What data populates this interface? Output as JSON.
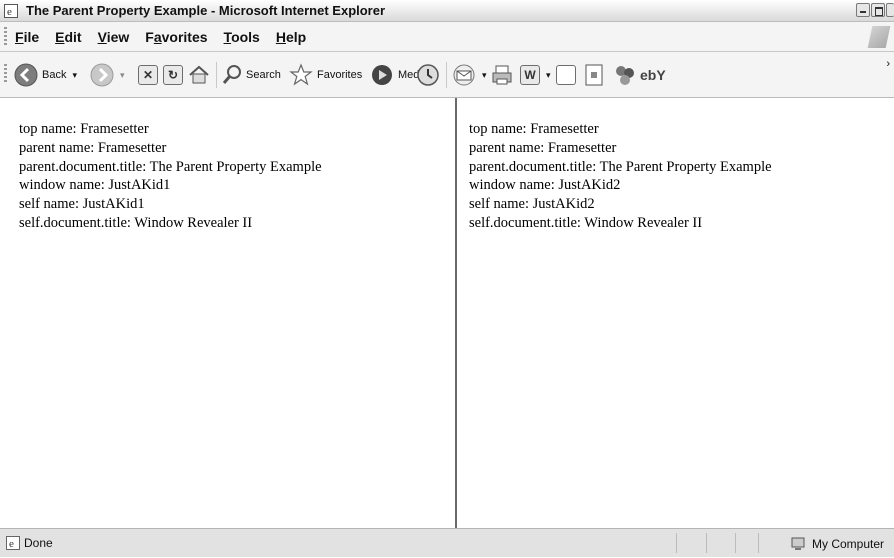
{
  "window": {
    "title": "The Parent Property Example - Microsoft Internet Explorer"
  },
  "menubar": {
    "items": [
      {
        "accel": "F",
        "rest": "ile"
      },
      {
        "accel": "E",
        "rest": "dit"
      },
      {
        "accel": "V",
        "rest": "iew"
      },
      {
        "pre": "F",
        "accel": "a",
        "rest": "vorites"
      },
      {
        "accel": "T",
        "rest": "ools"
      },
      {
        "accel": "H",
        "rest": "elp"
      }
    ]
  },
  "toolbar": {
    "back_label": "Back",
    "search_label": "Search",
    "favorites_label": "Favorites",
    "media_label": "Media",
    "word_glyph": "W",
    "ebay_glyph": "ebY"
  },
  "frames": {
    "left": {
      "lines": [
        "top name: Framesetter",
        "parent name: Framesetter",
        "parent.document.title: The Parent Property Example",
        "window name: JustAKid1",
        "self name: JustAKid1",
        "self.document.title: Window Revealer II"
      ]
    },
    "right": {
      "lines": [
        "top name: Framesetter",
        "parent name: Framesetter",
        "parent.document.title: The Parent Property Example",
        "window name: JustAKid2",
        "self name: JustAKid2",
        "self.document.title: Window Revealer II"
      ]
    }
  },
  "statusbar": {
    "status_text": "Done",
    "zone_text": "My Computer"
  },
  "icons": {
    "ie": "ie-icon",
    "back": "back-arrow-icon",
    "forward": "forward-arrow-icon",
    "stop": "stop-icon",
    "refresh": "refresh-icon",
    "home": "home-icon",
    "search": "search-magnifier-icon",
    "favorites": "favorites-star-icon",
    "media": "media-icon",
    "history": "history-icon",
    "mail": "mail-icon",
    "print": "print-icon",
    "edit": "word-edit-icon",
    "discuss": "discuss-icon",
    "messenger": "messenger-icon",
    "zone": "my-computer-icon"
  }
}
